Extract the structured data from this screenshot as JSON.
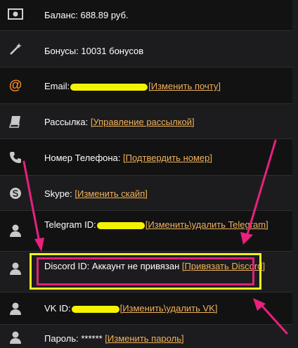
{
  "rows": {
    "balance": {
      "text": "Баланс: 688.89 руб."
    },
    "bonus": {
      "text": "Бонусы: 10031 бонусов"
    },
    "email": {
      "label": "Email:",
      "link": "[Изменить почту]"
    },
    "mailing": {
      "label": "Рассылка: ",
      "link": "[Управление рассылкой]"
    },
    "phone": {
      "label": "Номер Телефона: ",
      "link": "[Подтвердить номер]"
    },
    "skype": {
      "label": "Skype: ",
      "link": "[Изменить скайп]"
    },
    "telegram": {
      "label": "Telegram ID:",
      "link": "[Изменить\\удалить Telegram]"
    },
    "discord": {
      "label": "Discord ID: Аккаунт не привязан ",
      "link": "[Привязать Discord]"
    },
    "vk": {
      "label": "VK ID:",
      "link": "[Изменить\\удалить VK]"
    },
    "password": {
      "label": "Пароль: ****** ",
      "link": "[Изменить пароль]"
    }
  },
  "colors": {
    "link": "#f0b25a",
    "highlight_yellow": "#f2f21a",
    "highlight_pink": "#e0207a",
    "redaction": "#f4f400"
  },
  "icons": [
    "money-icon",
    "magic-wand-icon",
    "at-icon",
    "book-icon",
    "phone-icon",
    "skype-icon",
    "user-icon"
  ]
}
